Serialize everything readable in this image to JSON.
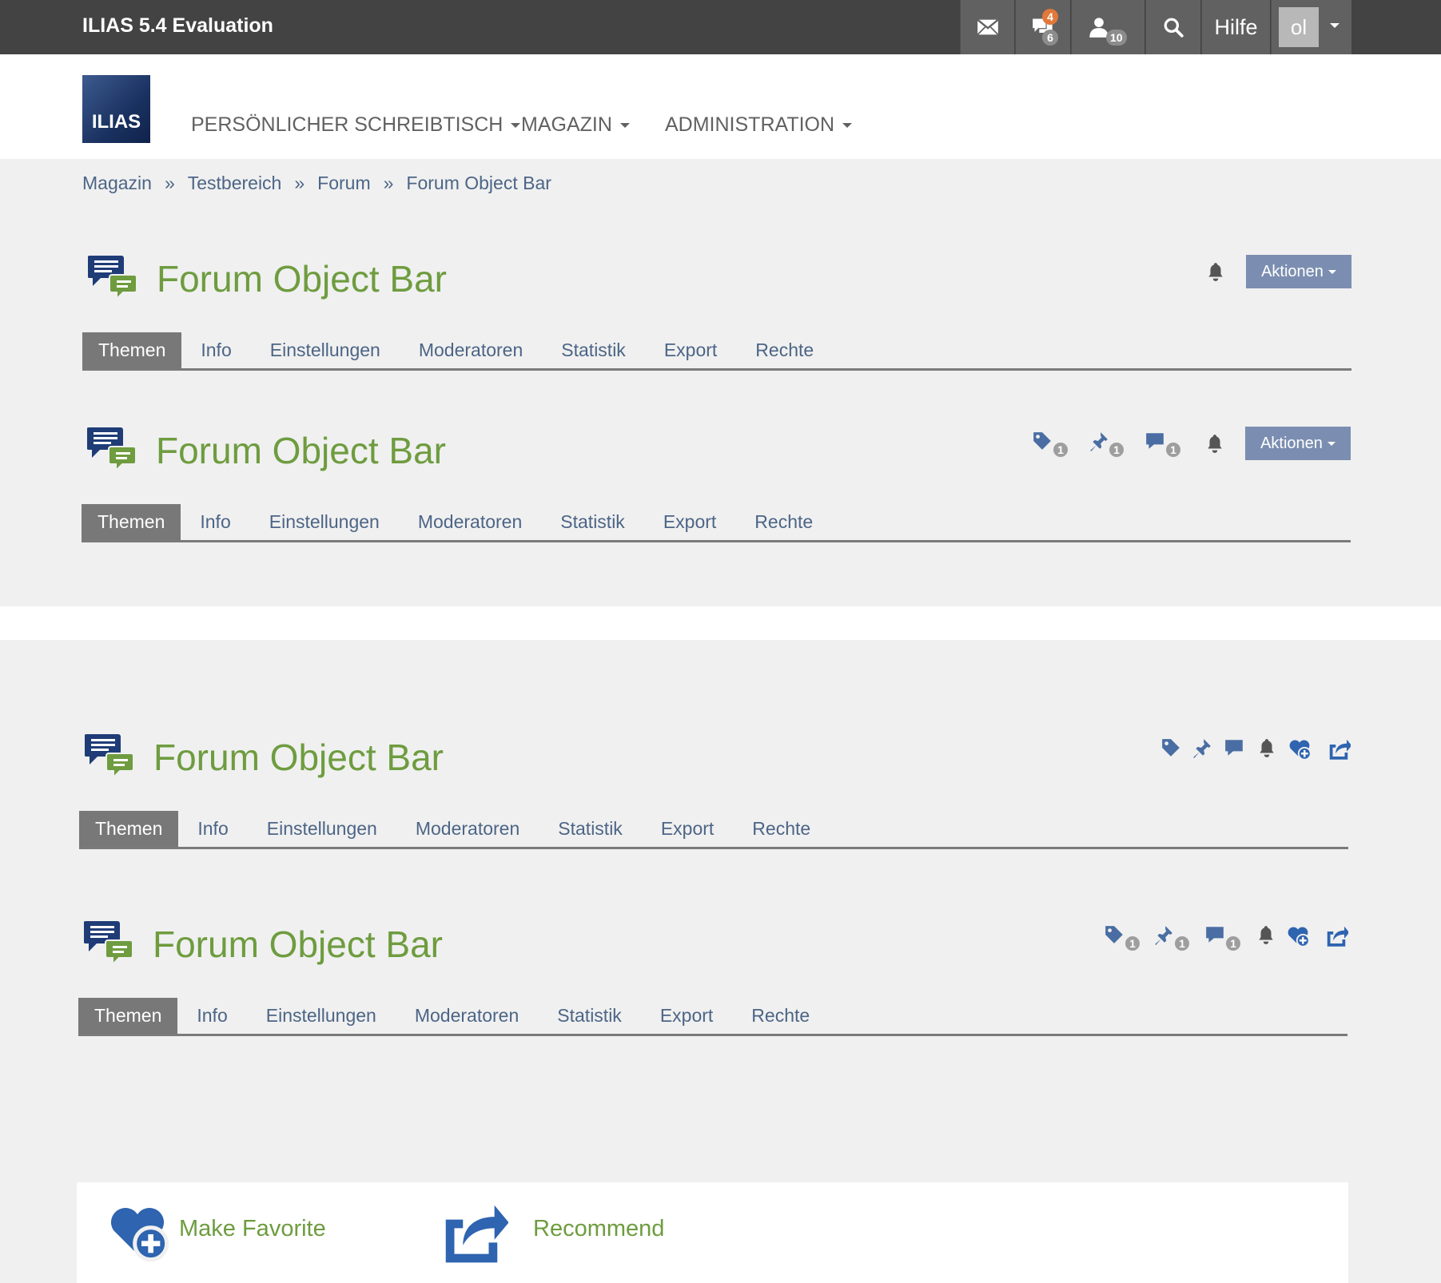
{
  "topbar": {
    "title": "ILIAS 5.4 Evaluation",
    "mail_icon": "envelope-icon",
    "chat_badge_new": "4",
    "chat_badge_total": "6",
    "users_badge": "10",
    "help_label": "Hilfe",
    "avatar_text": "ol"
  },
  "mainnav": {
    "items": [
      "PERSÖNLICHER SCHREIBTISCH",
      "MAGAZIN",
      "ADMINISTRATION"
    ],
    "logo_text": "ILIAS"
  },
  "breadcrumb": [
    "Magazin",
    "Testbereich",
    "Forum",
    "Forum Object Bar"
  ],
  "breadcrumb_sep": "»",
  "object_title": "Forum Object Bar",
  "actions_label": "Aktionen",
  "tabs": [
    "Themen",
    "Info",
    "Einstellungen",
    "Moderatoren",
    "Statistik",
    "Export",
    "Rechte"
  ],
  "counts": {
    "tags": "1",
    "pins": "1",
    "comments": "1"
  },
  "bottom": {
    "favorite_label": "Make Favorite",
    "recommend_label": "Recommend"
  },
  "colors": {
    "title_green": "#6e9c3f",
    "link_blue": "#4c6586",
    "icon_blue": "#4a6ea3",
    "action_btn": "#7b8eb1",
    "topbar": "#434343"
  }
}
